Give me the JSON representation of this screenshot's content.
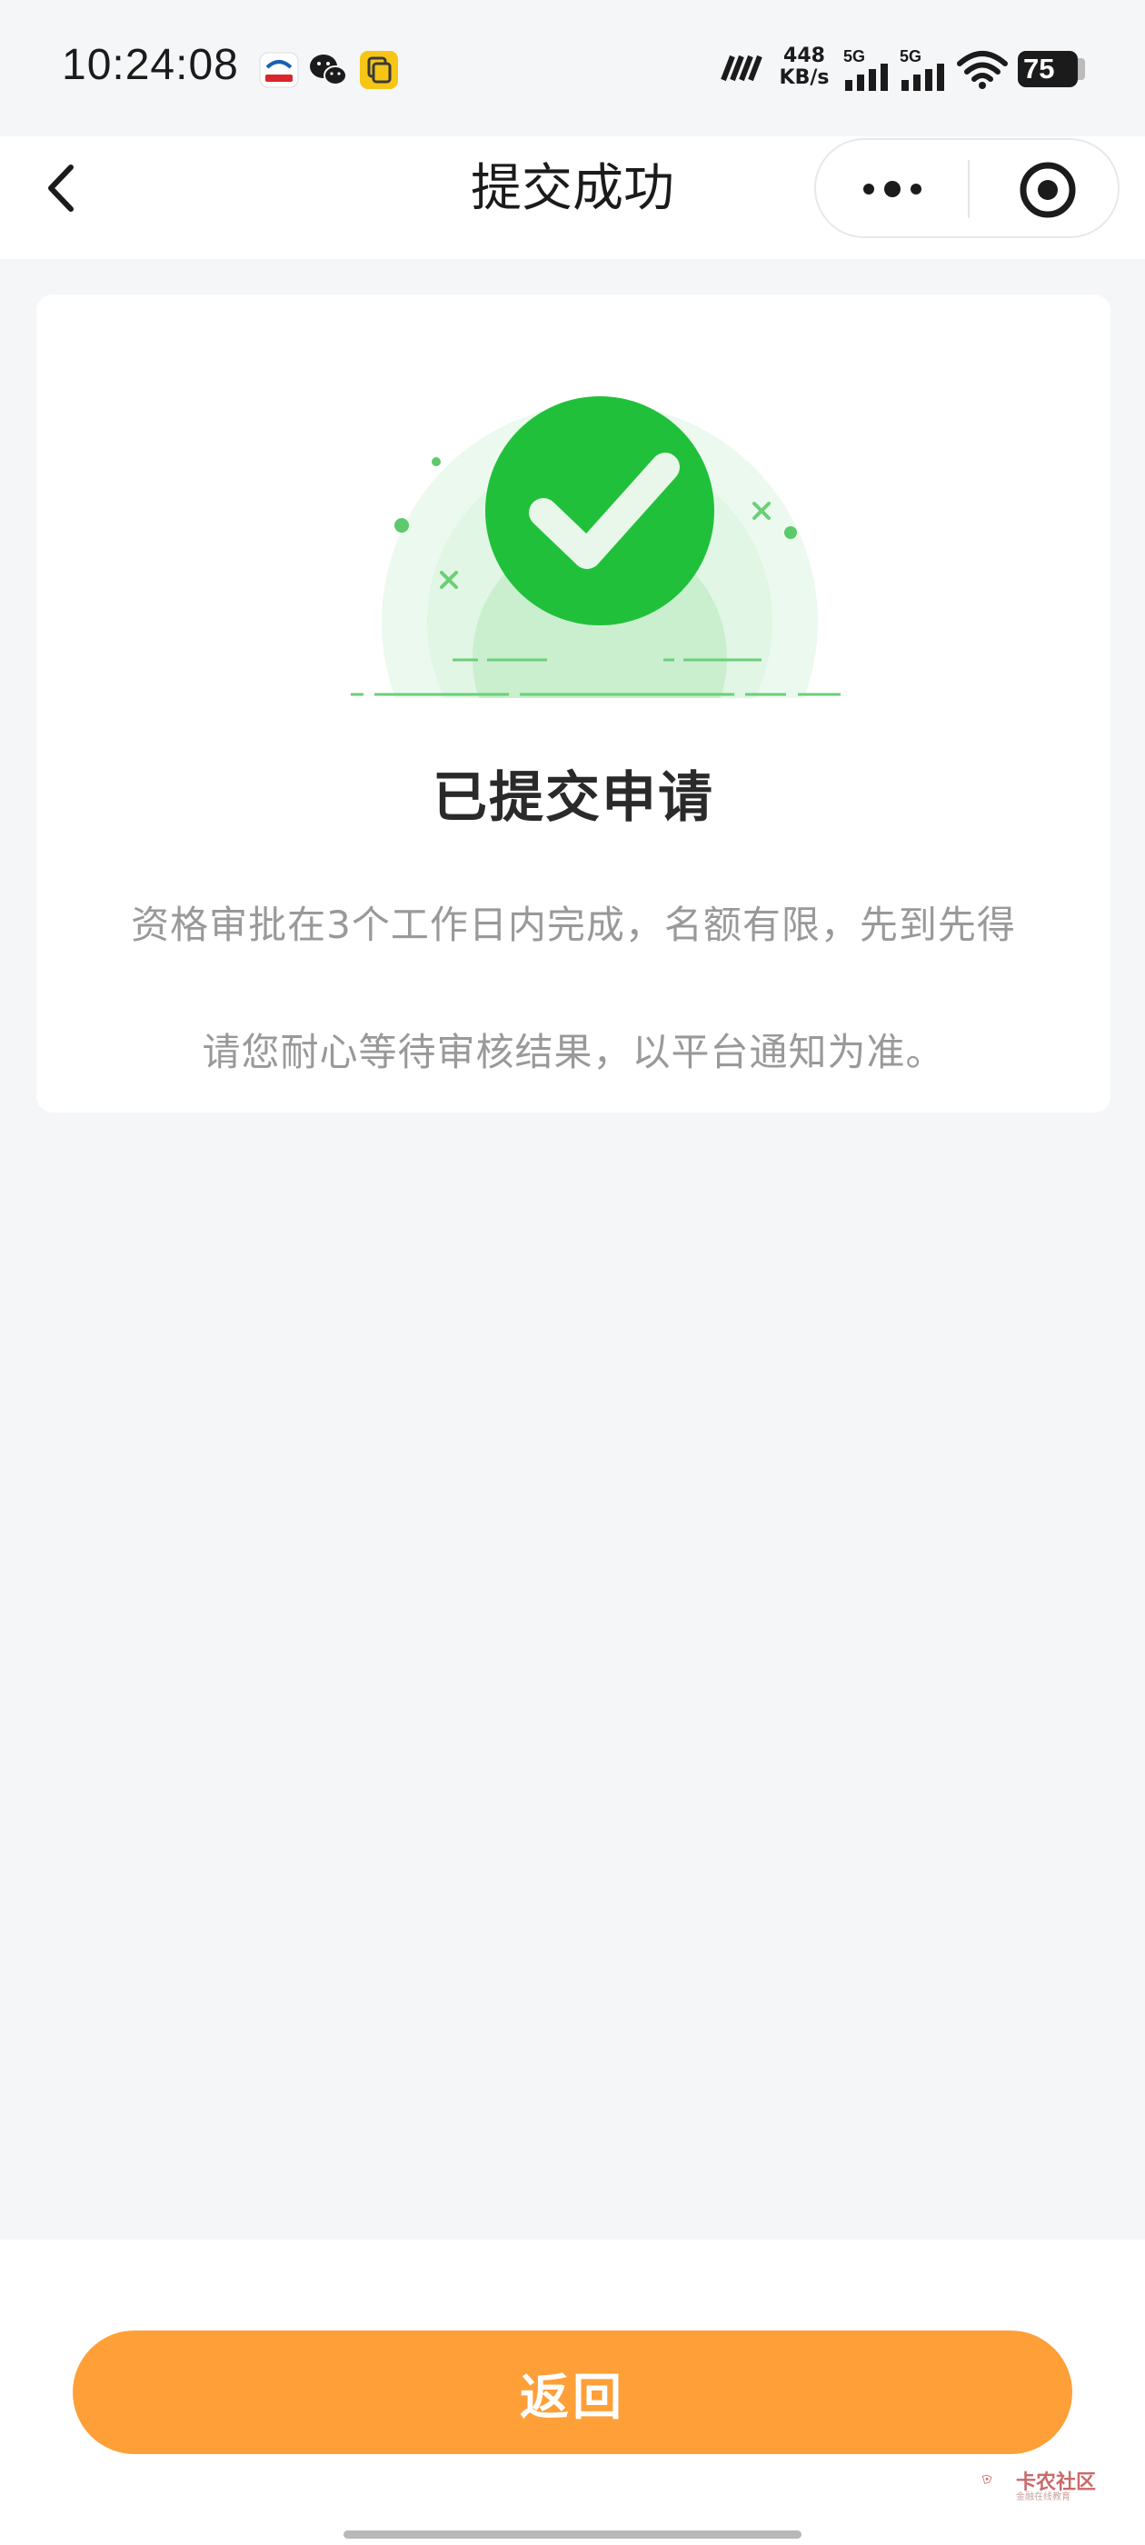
{
  "status_bar": {
    "time": "10:24:08",
    "net_speed_value": "448",
    "net_speed_unit": "KB/s",
    "signal1_label": "5G",
    "signal2_label": "5G",
    "battery": "75",
    "notification_icons": [
      "railway-app-icon",
      "wechat-icon",
      "clipboard-app-icon"
    ]
  },
  "nav": {
    "title": "提交成功",
    "back_icon": "chevron-left-icon",
    "more_icon": "more-dots-icon",
    "close_icon": "target-close-icon"
  },
  "card": {
    "title": "已提交申请",
    "line1": "资格审批在3个工作日内完成，名额有限，先到先得",
    "line2": "请您耐心等待审核结果，以平台通知为准。",
    "status_icon": "success-check-icon"
  },
  "footer": {
    "return_label": "返回"
  },
  "watermark": {
    "text": "卡农社区",
    "sub": "金融在线教育"
  },
  "colors": {
    "accent_orange": "#ff9f38",
    "success_green": "#21c03b",
    "page_bg": "#f5f6f8"
  }
}
